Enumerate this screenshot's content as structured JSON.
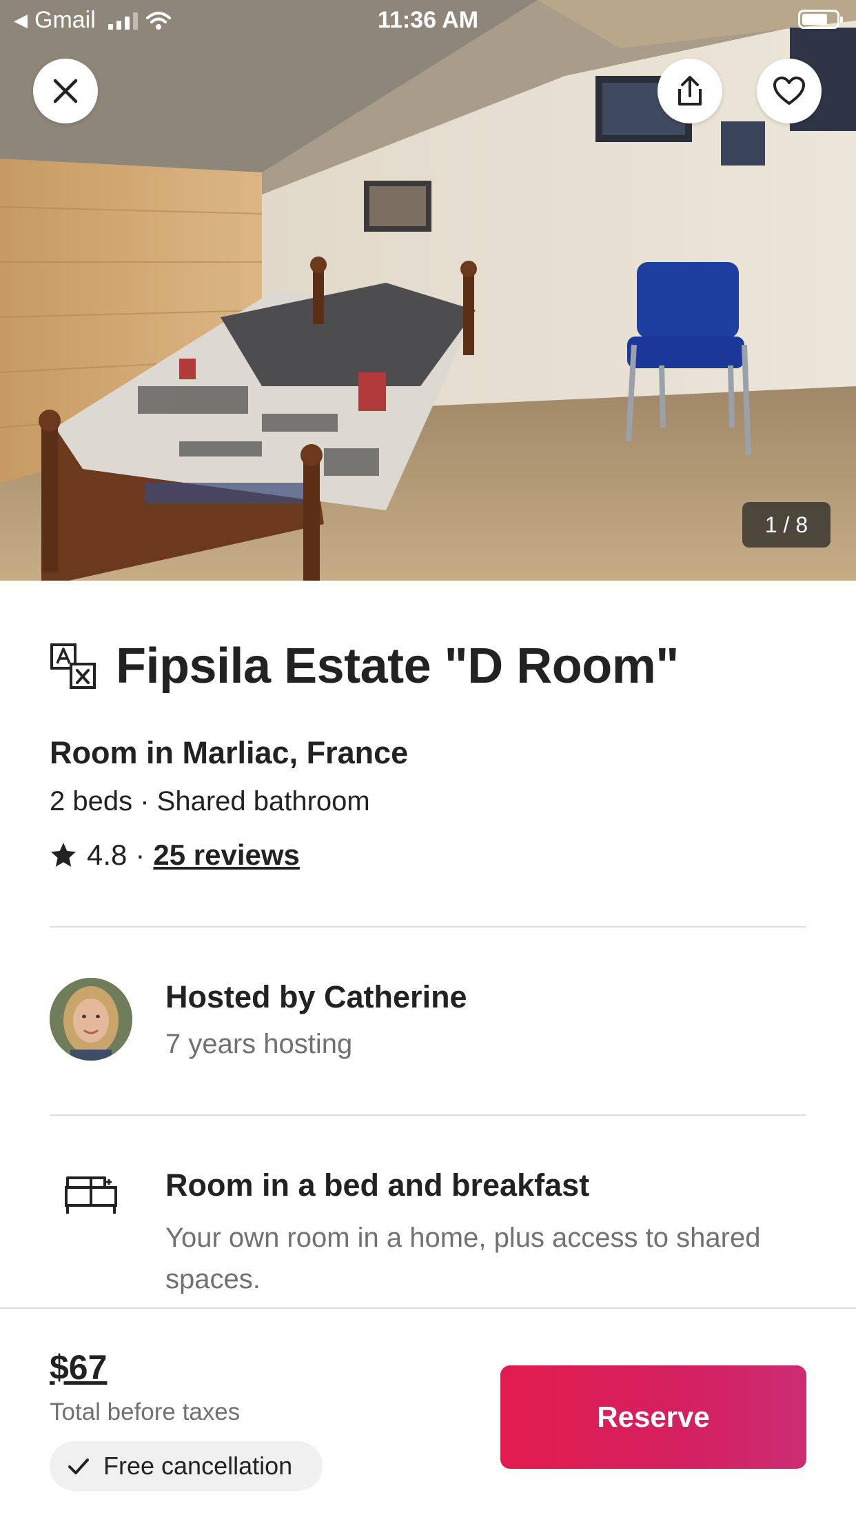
{
  "status_bar": {
    "back_app": "Gmail",
    "time": "11:36 AM",
    "icons": [
      "signal-icon",
      "wifi-icon",
      "battery-icon"
    ]
  },
  "gallery": {
    "counter": "1 / 8",
    "photo_description_icon": "bedroom-photo",
    "actions": [
      "close-icon",
      "share-icon",
      "heart-icon"
    ]
  },
  "listing": {
    "title": "Fipsila Estate \"D Room\"",
    "subtitle": "Room in Marliac, France",
    "details": "2 beds · Shared bathroom",
    "rating": "4.8",
    "separator": "·",
    "reviews": "25 reviews"
  },
  "host": {
    "name": "Hosted by Catherine",
    "years": "7 years hosting"
  },
  "room_type": {
    "title": "Room in a bed and breakfast",
    "description": "Your own room in a home, plus access to shared spaces."
  },
  "footer": {
    "price": "$67",
    "price_note": "Total before taxes",
    "cancellation": "Free cancellation",
    "reserve_label": "Reserve"
  },
  "colors": {
    "brand": "#E21C4E",
    "text": "#222222",
    "muted": "#717171",
    "divider": "#DDDDDD"
  }
}
